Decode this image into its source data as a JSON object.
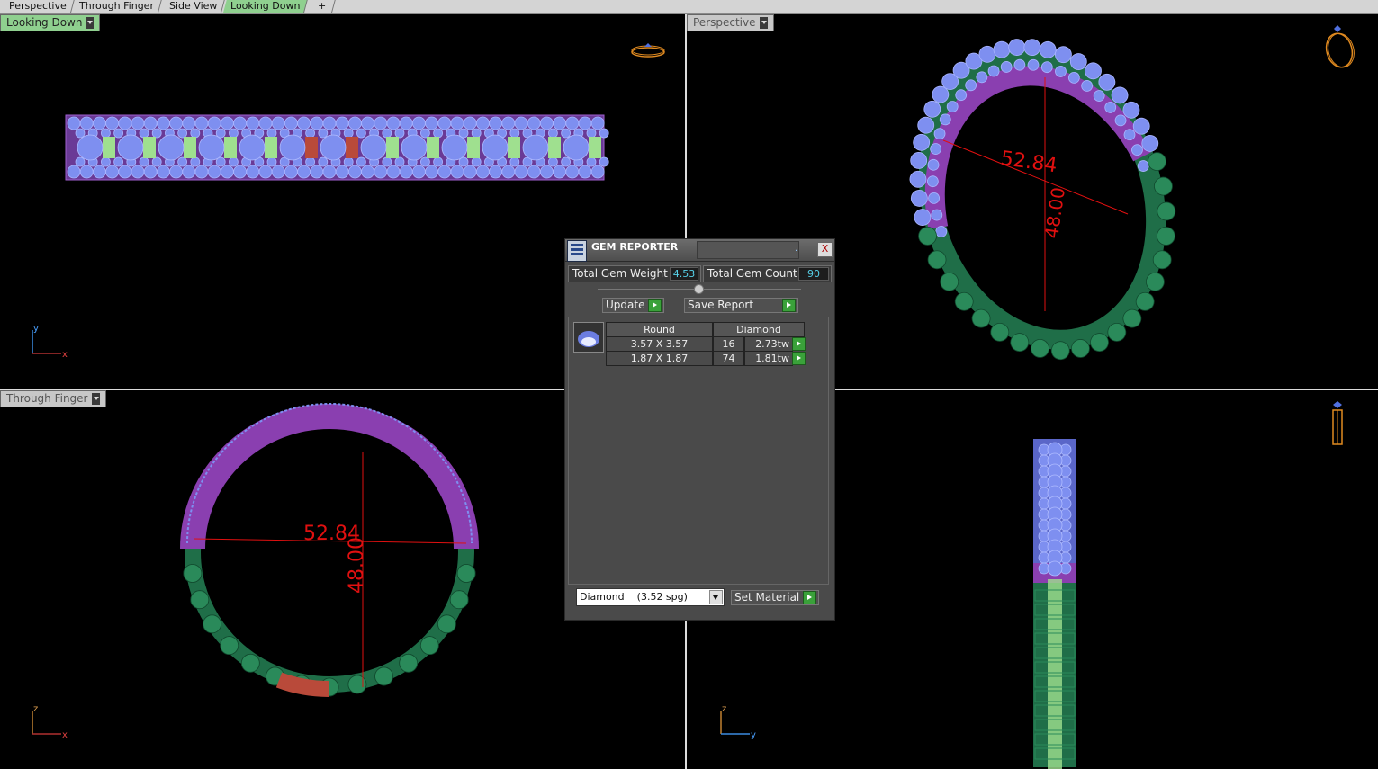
{
  "tabs": [
    {
      "label": "Perspective",
      "active": false
    },
    {
      "label": "Through Finger",
      "active": false
    },
    {
      "label": "Side View",
      "active": false
    },
    {
      "label": "Looking Down",
      "active": true
    }
  ],
  "tab_add_symbol": "+",
  "viewports": {
    "top_left": {
      "label": "Looking Down",
      "axis_v": "y",
      "axis_h": "x"
    },
    "top_right": {
      "label": "Perspective"
    },
    "bottom_left": {
      "label": "Through Finger",
      "axis_v": "z",
      "axis_h": "x",
      "dim_width": "52.84",
      "dim_height": "48.00"
    },
    "bottom_right": {
      "axis_v": "z",
      "axis_h": "y"
    },
    "perspective_dims": {
      "dim_width": "52.84",
      "dim_height": "48.00"
    }
  },
  "gem_reporter": {
    "title": "GEM REPORTER",
    "close": "X",
    "dot": ".",
    "total_weight_label": "Total Gem Weight",
    "total_weight_value": "4.53",
    "total_count_label": "Total Gem Count",
    "total_count_value": "90",
    "update_label": "Update",
    "save_report_label": "Save Report",
    "table": {
      "headers": [
        "Round",
        "Diamond"
      ],
      "rows": [
        {
          "size": "3.57 X 3.57",
          "count": "16",
          "weight": "2.73tw"
        },
        {
          "size": "1.87 X 1.87",
          "count": "74",
          "weight": "1.81tw"
        }
      ]
    },
    "material_select": "Diamond    (3.52 spg)",
    "set_material_label": "Set Material"
  },
  "colors": {
    "active_tab": "#8fd08f",
    "gem_blue": "#7e8ff0",
    "metal_purple": "#8a3fb0",
    "green_dark": "#1f6e48",
    "green_light": "#9fe08f",
    "red_section": "#b94a3a",
    "dimension_red": "#e01010",
    "value_cyan": "#56d0e8"
  }
}
